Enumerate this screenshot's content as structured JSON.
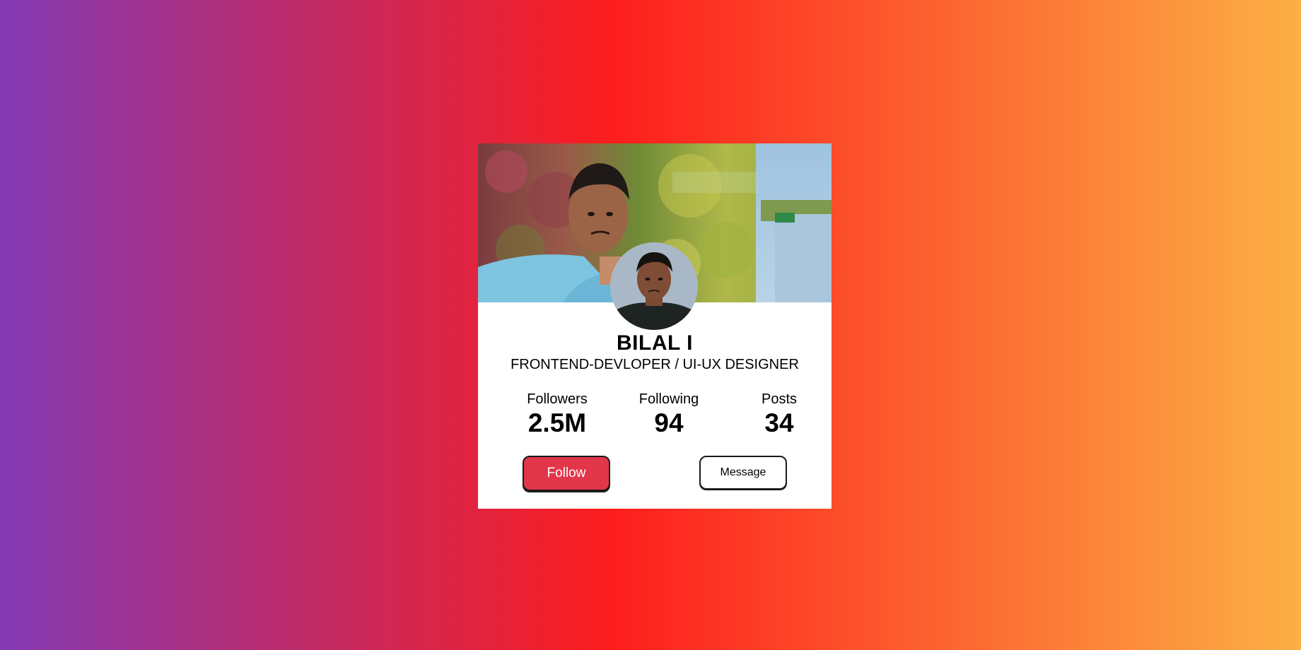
{
  "profile": {
    "name": "BILAL I",
    "role": "FRONTEND-DEVLOPER / UI-UX DESIGNER"
  },
  "stats": {
    "followers": {
      "label": "Followers",
      "value": "2.5M"
    },
    "following": {
      "label": "Following",
      "value": "94"
    },
    "posts": {
      "label": "Posts",
      "value": "34"
    }
  },
  "actions": {
    "follow_label": "Follow",
    "message_label": "Message"
  },
  "colors": {
    "gradient_start": "#833ab4",
    "gradient_mid": "#fd1d1d",
    "gradient_end": "#fcb045",
    "follow_button": "#e2364a"
  },
  "images": {
    "cover": "cover-photo",
    "avatar": "profile-avatar"
  }
}
